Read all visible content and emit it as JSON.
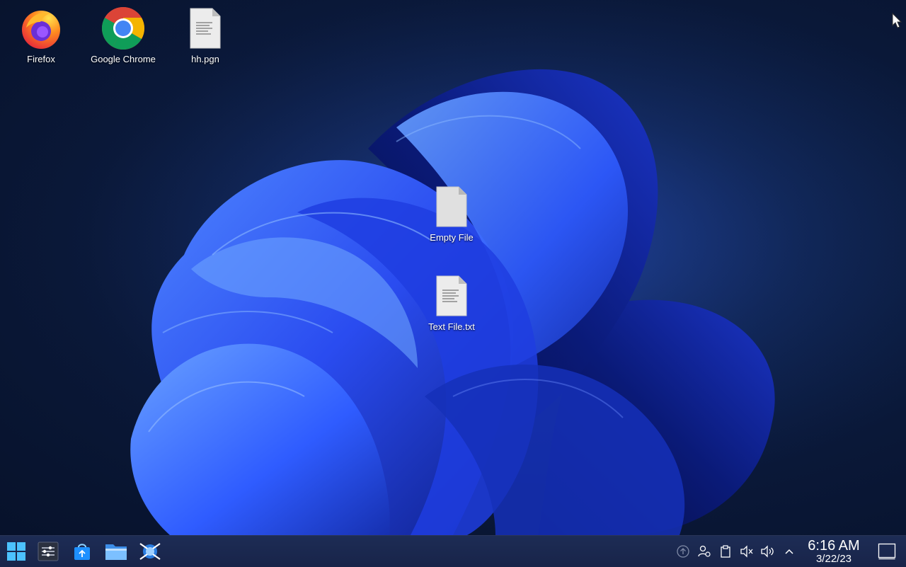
{
  "desktop": {
    "icons": [
      {
        "label": "Firefox",
        "icon": "firefox-icon"
      },
      {
        "label": "Google Chrome",
        "icon": "chrome-icon"
      },
      {
        "label": "hh.pgn",
        "icon": "text-document-icon"
      },
      {
        "label": "Empty File",
        "icon": "blank-file-icon"
      },
      {
        "label": "Text File.txt",
        "icon": "text-document-icon"
      }
    ]
  },
  "taskbar": {
    "launchers": [
      "start-menu-icon",
      "system-settings-icon",
      "software-store-icon",
      "file-manager-icon",
      "network-tool-icon"
    ],
    "tray": [
      "updates-icon",
      "user-switch-icon",
      "clipboard-icon",
      "mute-icon",
      "volume-icon",
      "expand-tray-icon"
    ],
    "clock": {
      "time": "6:16 AM",
      "date": "3/22/23"
    }
  },
  "colors": {
    "taskbar": "#1d2c55",
    "wallpaper_accent": "#2a4dff",
    "desktop_bg": "#0b1833"
  }
}
